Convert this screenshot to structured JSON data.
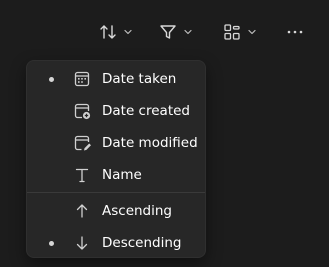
{
  "toolbar": {
    "buttons": [
      {
        "name": "sort",
        "icon": "sort-arrows-icon",
        "has_dropdown": true
      },
      {
        "name": "filter",
        "icon": "funnel-icon",
        "has_dropdown": true
      },
      {
        "name": "view",
        "icon": "grid-layout-icon",
        "has_dropdown": true
      },
      {
        "name": "more",
        "icon": "more-horizontal-icon",
        "has_dropdown": false
      }
    ]
  },
  "sort_menu": {
    "items": [
      {
        "label": "Date taken",
        "icon": "calendar-icon",
        "selected": true
      },
      {
        "label": "Date created",
        "icon": "calendar-add-icon",
        "selected": false
      },
      {
        "label": "Date modified",
        "icon": "calendar-edit-icon",
        "selected": false
      },
      {
        "label": "Name",
        "icon": "text-t-icon",
        "selected": false
      }
    ],
    "order": [
      {
        "label": "Ascending",
        "icon": "arrow-up-icon",
        "selected": false
      },
      {
        "label": "Descending",
        "icon": "arrow-down-icon",
        "selected": true
      }
    ]
  },
  "colors": {
    "background": "#1c1c1c",
    "menu_background": "#272727",
    "text": "#ffffff",
    "icon": "#d0d0d0"
  }
}
